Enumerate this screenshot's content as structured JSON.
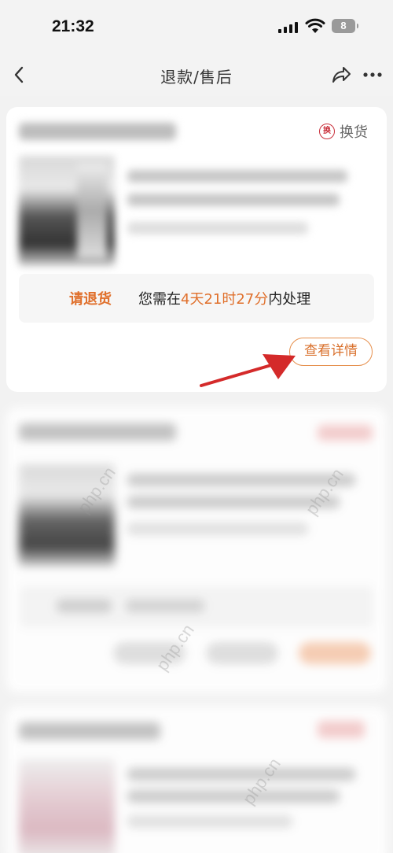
{
  "status_bar": {
    "time": "21:32",
    "battery": "8"
  },
  "nav": {
    "title": "退款/售后"
  },
  "orders": [
    {
      "tag_icon": "换",
      "tag_label": "换货",
      "notice_label": "请退货",
      "notice_prefix": "您需在",
      "notice_time": "4天21时27分",
      "notice_suffix": "内处理",
      "detail_button": "查看详情"
    }
  ],
  "watermarks": [
    "php.cn",
    "php.cn",
    "php.cn",
    "php.cn"
  ],
  "colors": {
    "accent": "#e0702c",
    "tag_red": "#c9303b",
    "arrow": "#d42a2a"
  }
}
